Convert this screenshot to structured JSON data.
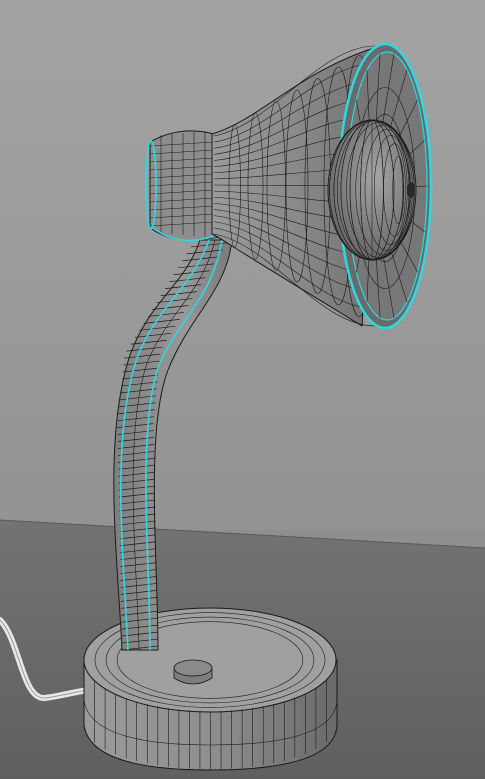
{
  "scene": {
    "subject": "desk-lamp-wireframe-render",
    "colors": {
      "wall": "#9a9a9a",
      "floor": "#6f6f6f",
      "mesh_surface": "#8c8c8c",
      "wire": "#1a1a1a",
      "selection_highlight": "#2fd8e0",
      "bulb": "#7a7a7a",
      "cable": "#e6e6e6"
    }
  }
}
